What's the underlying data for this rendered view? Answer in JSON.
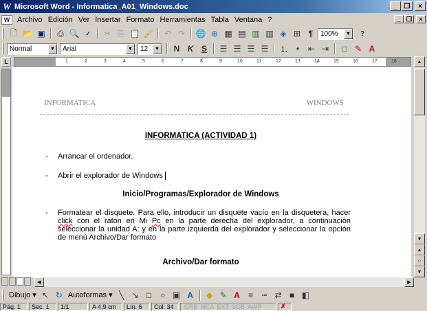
{
  "window": {
    "title": "Microsoft Word - Informatica_A01_Windows.doc",
    "app_icon": "W",
    "minimize": "_",
    "maximize": "❐",
    "close": "×"
  },
  "menu": {
    "items": [
      "Archivo",
      "Edición",
      "Ver",
      "Insertar",
      "Formato",
      "Herramientas",
      "Tabla",
      "Ventana",
      "?"
    ]
  },
  "toolbar_standard": {
    "zoom": "100%"
  },
  "toolbar_format": {
    "style": "Normal",
    "font": "Arial",
    "size": "12",
    "bold": "N",
    "italic": "K",
    "underline": "S"
  },
  "ruler": {
    "numbers": [
      "1",
      "2",
      "3",
      "4",
      "5",
      "6",
      "7",
      "8",
      "9",
      "10",
      "11",
      "12",
      "13",
      "14",
      "15",
      "16",
      "17",
      "18"
    ]
  },
  "document": {
    "header_left": "INFORMATICA",
    "header_right": "WINDOWS",
    "title": "INFORMATICA (ACTIVIDAD 1)",
    "bullet_char": "-",
    "item1": "Arrancar el ordenador.",
    "item2": "Abrir el explorador de Windows",
    "path1": "Inicio/Programas/Explorador de Windows",
    "item3_part1": "Formatear el disquete. Para ello, introducir un disquete vacío en la disquetera, hacer ",
    "item3_click": "click",
    "item3_part2": " con el ratón en Mi ",
    "item3_pc": "Pc",
    "item3_part3": " en la parte derecha del explorador, a continuación seleccionar la unidad A: y en la parte izquierda del explorador y seleccionar la opción de menú Archivo/Dar formato",
    "path2": "Archivo/Dar formato"
  },
  "drawing_toolbar": {
    "dibujo": "Dibujo",
    "autoformas": "Autoformas"
  },
  "status": {
    "page": "Pág. 1",
    "section": "Sec. 1",
    "pages": "1/1",
    "at": "A 4,9 cm",
    "line": "Lín. 6",
    "col": "Col. 34",
    "modes": [
      "GRB",
      "MCA",
      "EXT",
      "SOB",
      "AWP"
    ]
  }
}
